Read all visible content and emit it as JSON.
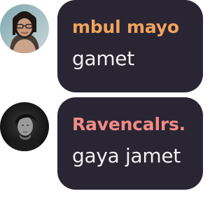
{
  "messages": [
    {
      "author": "mbul mayo",
      "author_color": "#f0a35c",
      "text": "gamet",
      "avatar": "user-avatar-photo"
    },
    {
      "author": "Ravencalrs.",
      "author_color": "#f28b84",
      "text": "gaya jamet",
      "avatar": "user-avatar-photo"
    }
  ],
  "colors": {
    "bubble_background": "#2a2533",
    "message_text": "#f2f0f5",
    "page_background": "#ffffff"
  }
}
